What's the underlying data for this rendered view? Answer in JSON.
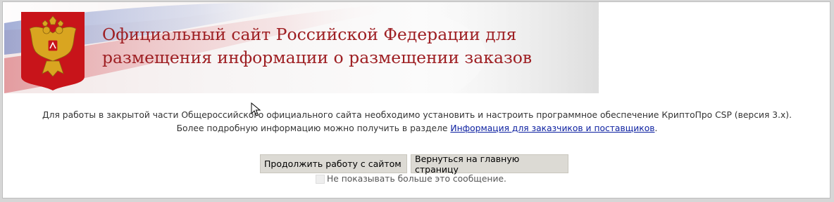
{
  "banner": {
    "title_line1": "Официальный сайт Российской Федерации для",
    "title_line2": "размещения информации о размещении заказов",
    "emblem_icon": "russian-coat-of-arms-icon"
  },
  "notice": {
    "line1": "Для работы в закрытой части Общероссийского официального сайта необходимо установить и настроить программное обеспечение КриптоПро CSP (версия 3.x).",
    "line2_prefix": "Более подробную информацию можно получить в разделе",
    "link_text": "Информация для заказчиков и поставщиков",
    "line2_suffix": "."
  },
  "buttons": {
    "continue_label": "Продолжить работу с сайтом",
    "home_label": "Вернуться на главную страницу"
  },
  "dont_show": {
    "label": "Не показывать больше это сообщение.",
    "checked": false
  },
  "colors": {
    "title": "#9e1f23",
    "emblem_bg": "#c8141a",
    "link": "#0b1fa0",
    "button_bg": "#dcdad4"
  }
}
